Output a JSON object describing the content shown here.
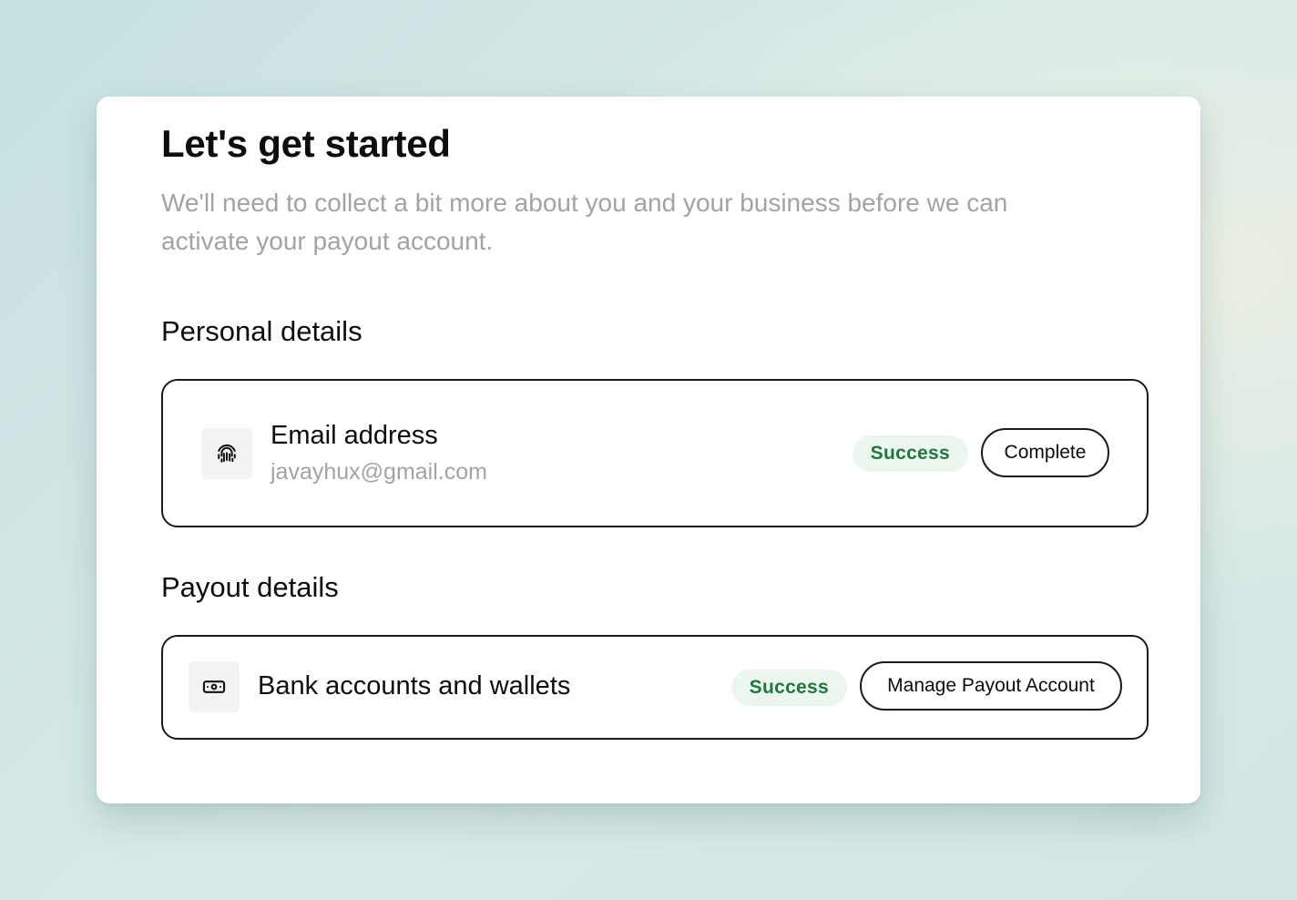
{
  "header": {
    "title": "Let's get started",
    "subtitle": "We'll need to collect a bit more about you and your business before we can activate your payout account."
  },
  "personal": {
    "section_title": "Personal details",
    "item": {
      "icon": "fingerprint-icon",
      "title": "Email address",
      "value": "javayhux@gmail.com",
      "status": "Success",
      "button_label": "Complete"
    }
  },
  "payout": {
    "section_title": "Payout details",
    "item": {
      "icon": "banknote-icon",
      "title": "Bank accounts and wallets",
      "status": "Success",
      "button_label": "Manage Payout Account"
    }
  },
  "colors": {
    "success_text": "#1e7a3c",
    "success_bg": "#eaf6ee",
    "muted_text": "#a3a3a3",
    "border": "#1a1a1a"
  }
}
